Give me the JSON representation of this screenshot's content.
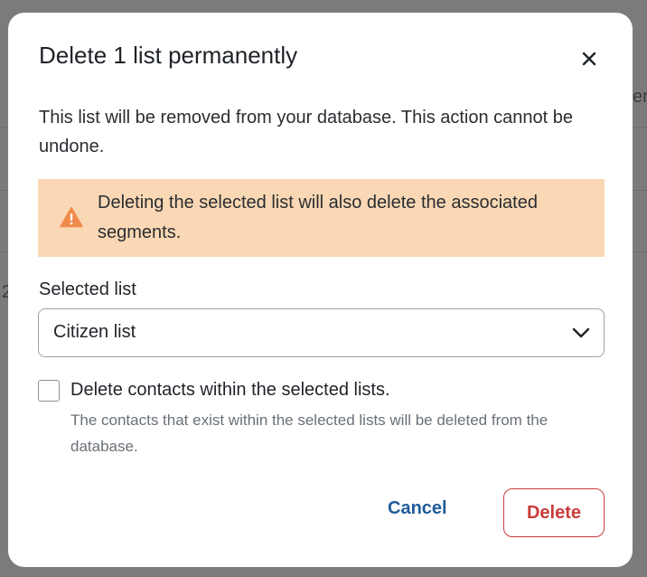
{
  "dialog": {
    "title": "Delete 1 list permanently",
    "description": "This list will be removed from your database. This action cannot be undone.",
    "warning": {
      "text": "Deleting the selected list will also delete the associated segments.",
      "icon": "warning-triangle-icon",
      "color": "#f08a4b",
      "background": "#fad8b5"
    },
    "selected_list": {
      "label": "Selected list",
      "value": "Citizen list"
    },
    "delete_contacts": {
      "label": "Delete contacts within the selected lists.",
      "help": "The contacts that exist within the selected lists will be deleted from the database.",
      "checked": false
    },
    "buttons": {
      "cancel": "Cancel",
      "delete": "Delete"
    },
    "colors": {
      "cancel": "#1f5c99",
      "delete": "#c93c3c"
    }
  },
  "background": {
    "fragment_right": "er",
    "fragment_left": "2"
  }
}
